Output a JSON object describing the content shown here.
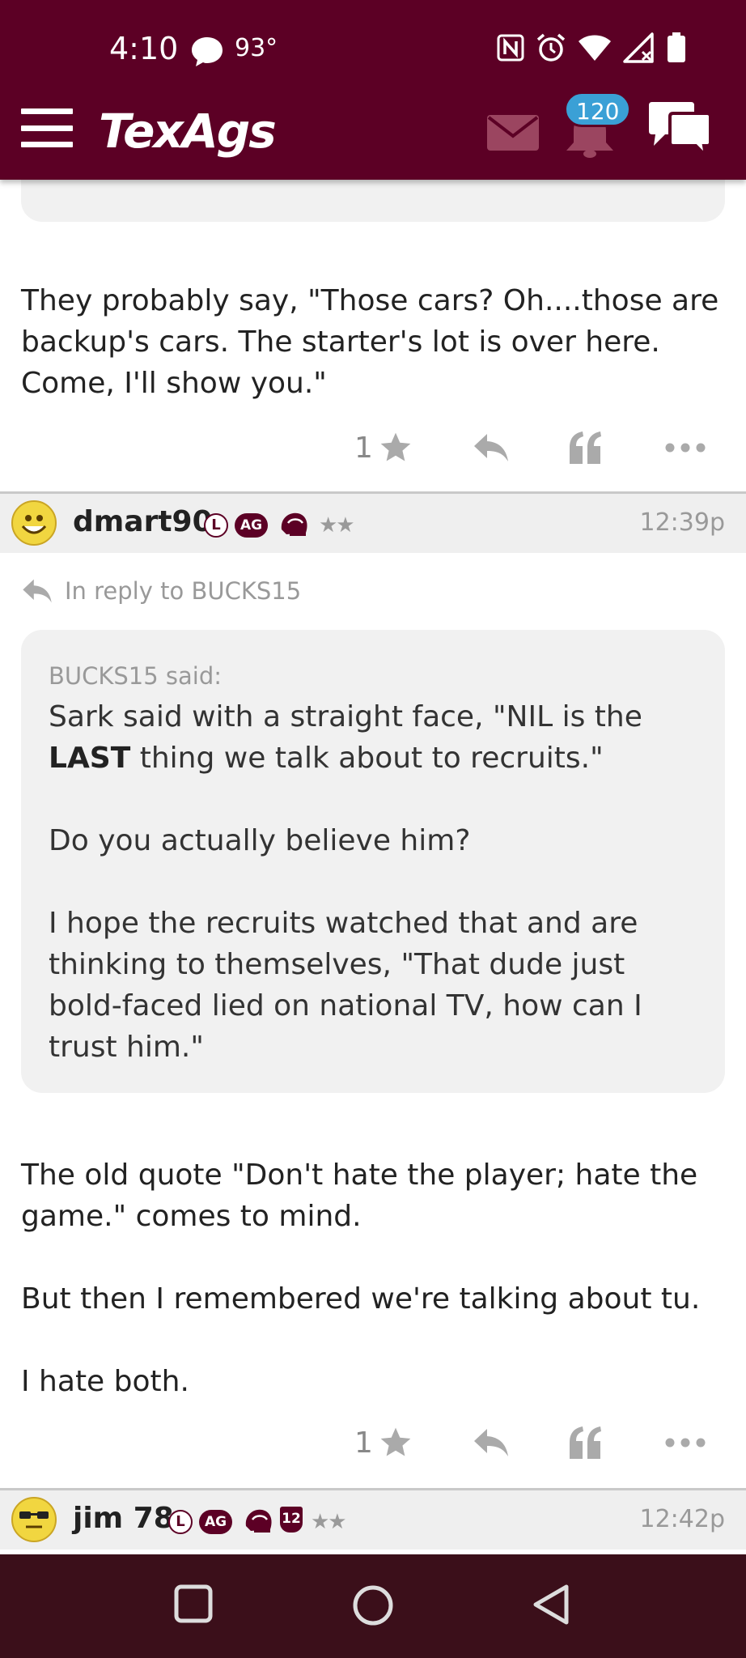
{
  "status_bar": {
    "time": "4:10",
    "temperature": "93°",
    "icons": [
      "chat-bubble-icon",
      "nfc-icon",
      "alarm-icon",
      "wifi-icon",
      "signal-icon",
      "battery-icon"
    ]
  },
  "app_bar": {
    "logo": "TexAgs",
    "notification_count": "120",
    "icons": [
      "menu-icon",
      "mail-icon",
      "bell-icon",
      "chat-icon"
    ],
    "colors": {
      "primary": "#5c0025",
      "badge": "#3aa0d6"
    }
  },
  "posts": [
    {
      "paragraphs": [
        "They probably say, \"Those cars? Oh....those are backup's cars. The starter's lot is over here. Come, I'll show you.\""
      ],
      "like_count": "1"
    },
    {
      "username": "dmart90",
      "badges": [
        "L",
        "AG"
      ],
      "time": "12:39p",
      "reply_to": "In reply to BUCKS15",
      "quote": {
        "author": "BUCKS15 said:",
        "p1_before": "Sark said with a straight face, \"NIL is the ",
        "p1_bold": "LAST",
        "p1_after": " thing we talk about to recruits.\"",
        "p2": "Do you actually believe him?",
        "p3": "I hope the recruits watched that and are thinking to themselves, \"That dude just bold-faced lied on national TV, how can I trust him.\""
      },
      "paragraphs": [
        "The old quote \"Don't hate the player; hate the game.\" comes to mind.",
        "But then I remembered we're talking about tu.",
        "I hate both."
      ],
      "like_count": "1"
    },
    {
      "username": "jim 78",
      "badges": [
        "L",
        "AG",
        "12"
      ],
      "time": "12:42p"
    }
  ],
  "stars": "★★",
  "nav": [
    "recents-button",
    "home-button",
    "back-button"
  ]
}
